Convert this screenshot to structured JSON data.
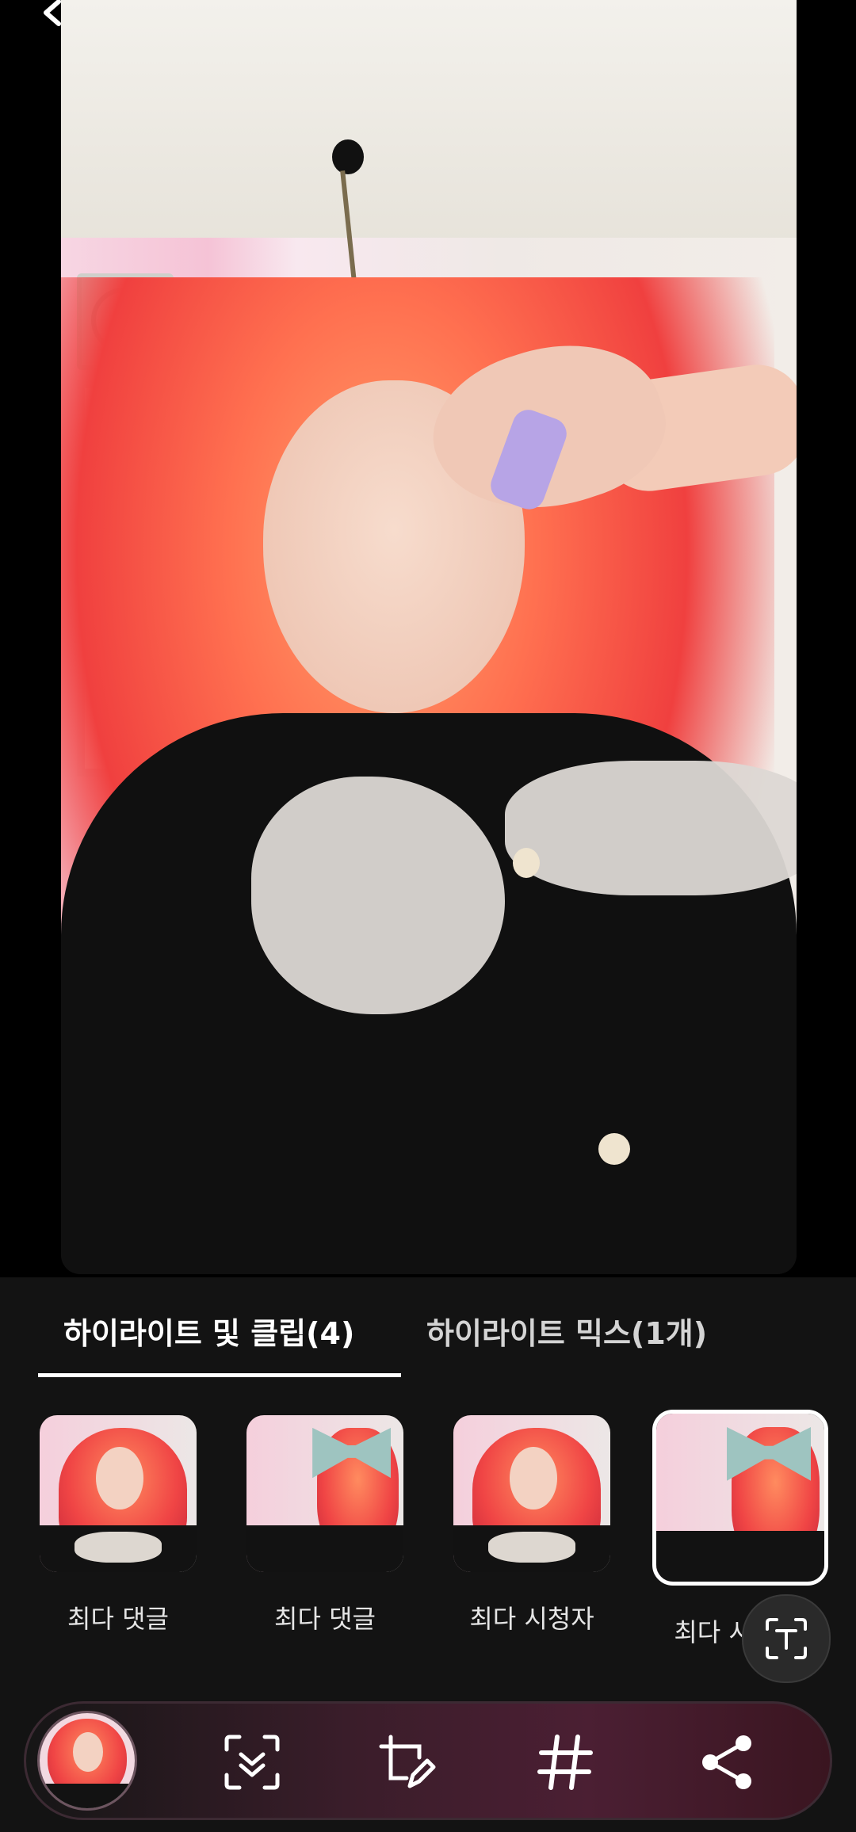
{
  "tabs": [
    {
      "label": "하이라이트 및 클립(4)",
      "selected": true
    },
    {
      "label": "하이라이트 믹스(1개)",
      "selected": false
    }
  ],
  "thumbnails": [
    {
      "label": "최다 댓글",
      "scene": "front",
      "selected": false
    },
    {
      "label": "최다 댓글",
      "scene": "back",
      "selected": false
    },
    {
      "label": "최다 시청자",
      "scene": "front",
      "selected": false
    },
    {
      "label": "최다 시청자",
      "scene": "back",
      "selected": true
    }
  ],
  "icons": {
    "back": "chevron-left-icon",
    "text_overlay": "text-box-icon",
    "scan": "scan-icon",
    "cover_edit": "cover-edit-icon",
    "hashtag": "hashtag-icon",
    "share": "share-icon"
  },
  "colors": {
    "accent": "#e3245b",
    "panel_bg": "#131313"
  }
}
